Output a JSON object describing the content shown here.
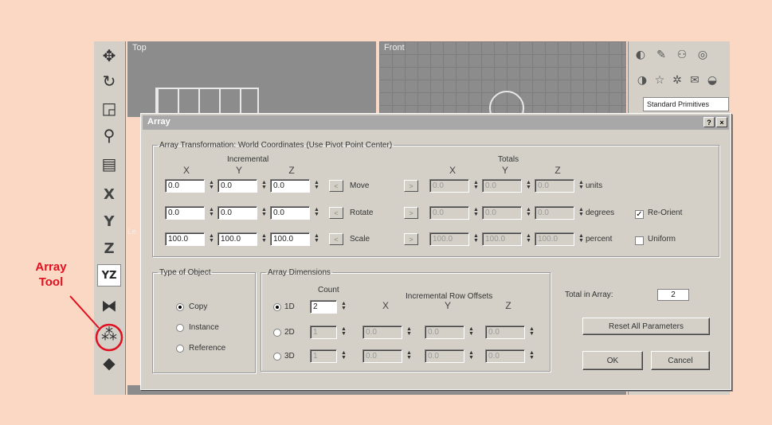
{
  "viewports": {
    "top_label": "Top",
    "front_label": "Front",
    "left_label": "Le"
  },
  "toolbar": {
    "items": [
      {
        "name": "move-icon",
        "glyph": "✥"
      },
      {
        "name": "rotate-icon",
        "glyph": "↻"
      },
      {
        "name": "scale-icon",
        "glyph": "◲"
      },
      {
        "name": "mirror-figure-icon",
        "glyph": "⚲"
      },
      {
        "name": "align-icon",
        "glyph": "▤"
      },
      {
        "name": "x-axis-icon",
        "glyph": "X"
      },
      {
        "name": "y-axis-icon",
        "glyph": "Y"
      },
      {
        "name": "z-axis-icon",
        "glyph": "Z"
      },
      {
        "name": "yz-axis-icon",
        "glyph": "YZ"
      },
      {
        "name": "mirror-icon",
        "glyph": "⧓"
      },
      {
        "name": "array-tool-icon",
        "glyph": "⁂"
      },
      {
        "name": "snapshot-icon",
        "glyph": "◆"
      }
    ]
  },
  "command_panel": {
    "dropdown": "Standard Primitives"
  },
  "dialog": {
    "title": "Array",
    "help_btn": "?",
    "close_btn": "×",
    "transform_legend": "Array Transformation: World Coordinates (Use Pivot Point Center)",
    "incremental_label": "Incremental",
    "totals_label": "Totals",
    "axes": [
      "X",
      "Y",
      "Z"
    ],
    "rows": [
      {
        "label": "Move",
        "inc": [
          "0.0",
          "0.0",
          "0.0"
        ],
        "tot": [
          "0.0",
          "0.0",
          "0.0"
        ],
        "unit": "units"
      },
      {
        "label": "Rotate",
        "inc": [
          "0.0",
          "0.0",
          "0.0"
        ],
        "tot": [
          "0.0",
          "0.0",
          "0.0"
        ],
        "unit": "degrees"
      },
      {
        "label": "Scale",
        "inc": [
          "100.0",
          "100.0",
          "100.0"
        ],
        "tot": [
          "100.0",
          "100.0",
          "100.0"
        ],
        "unit": "percent"
      }
    ],
    "reorient_label": "Re-Orient",
    "reorient_checked": "✓",
    "uniform_label": "Uniform",
    "type_legend": "Type of Object",
    "type_options": [
      "Copy",
      "Instance",
      "Reference"
    ],
    "dims_legend": "Array Dimensions",
    "count_label": "Count",
    "row_offsets_label": "Incremental Row Offsets",
    "dims": [
      {
        "label": "1D",
        "count": "2",
        "offsets": []
      },
      {
        "label": "2D",
        "count": "1",
        "offsets": [
          "0.0",
          "0.0",
          "0.0"
        ]
      },
      {
        "label": "3D",
        "count": "1",
        "offsets": [
          "0.0",
          "0.0",
          "0.0"
        ]
      }
    ],
    "total_label": "Total in Array:",
    "total_value": "2",
    "reset_label": "Reset All Parameters",
    "ok_label": "OK",
    "cancel_label": "Cancel"
  },
  "annotation": {
    "line1": "Array",
    "line2": "Tool",
    "color": "#e0101f"
  }
}
